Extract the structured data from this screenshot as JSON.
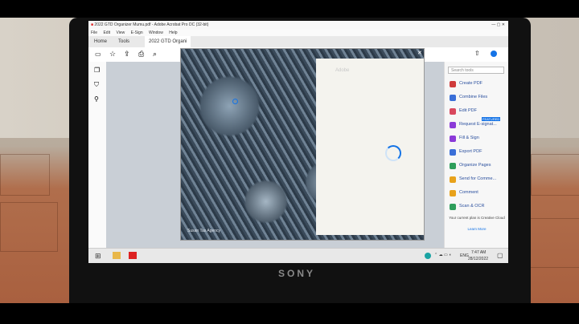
{
  "window": {
    "title": "2022 GTD Organizer Mumu.pdf - Adobe Acrobat Pro DC (32-bit)"
  },
  "menu": [
    "File",
    "Edit",
    "View",
    "E-Sign",
    "Window",
    "Help"
  ],
  "tabs": {
    "home": "Home",
    "tools": "Tools",
    "doc": "2022 GTD Organi"
  },
  "tools_panel": {
    "search_placeholder": "Search tools",
    "items": [
      "Create PDF",
      "Combine Files",
      "Edit PDF",
      "Request E-signat...",
      "Fill & Sign",
      "Export PDF",
      "Organize Pages",
      "Send for Comme...",
      "Comment",
      "Scan & OCR"
    ],
    "badge": "FEATURED",
    "plan_note": "Your current plan is Creative Cloud",
    "learn_more": "Learn More"
  },
  "modal": {
    "brand": "Adobe",
    "credit": "Susan Tas Agency"
  },
  "taskbar": {
    "time": "7:47 AM",
    "date": "28/12/2022",
    "lang": "ENG"
  },
  "bezel": {
    "brand": "SONY"
  }
}
